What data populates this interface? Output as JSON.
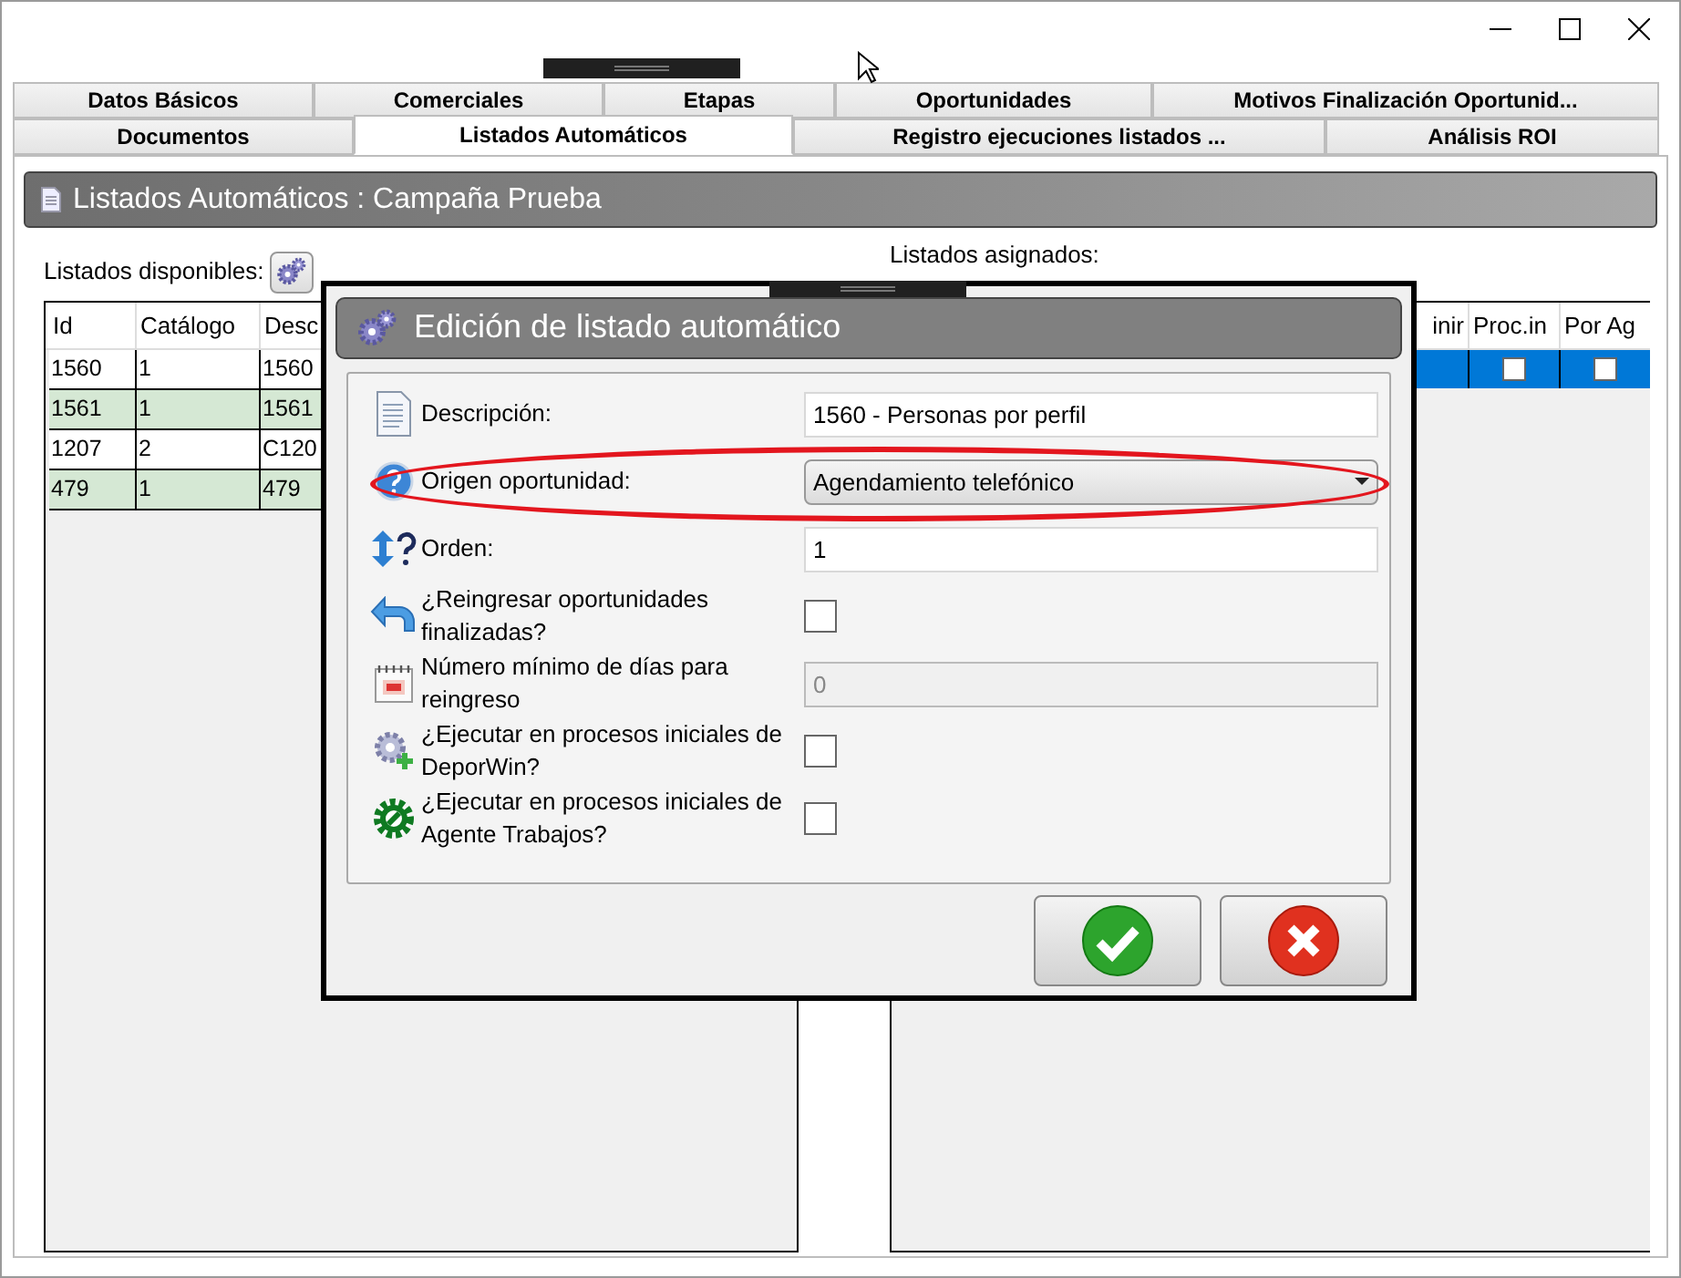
{
  "tabs": [
    [
      {
        "label": "Datos Básicos",
        "selected": false
      },
      {
        "label": "Comerciales",
        "selected": false
      },
      {
        "label": "Etapas",
        "selected": false
      },
      {
        "label": "Oportunidades",
        "selected": false
      },
      {
        "label": "Motivos Finalización Oportunid...",
        "selected": false
      }
    ],
    [
      {
        "label": "Documentos",
        "selected": false
      },
      {
        "label": "Listados Automáticos",
        "selected": true
      },
      {
        "label": "Registro ejecuciones listados ...",
        "selected": false
      },
      {
        "label": "Análisis ROI",
        "selected": false
      }
    ]
  ],
  "header": {
    "title": "Listados Automáticos : Campaña Prueba"
  },
  "available": {
    "label": "Listados disponibles:",
    "columns": [
      "Id",
      "Catálogo",
      "Desc"
    ],
    "rows": [
      {
        "cells": [
          "1560",
          "1",
          "1560"
        ]
      },
      {
        "cells": [
          "1561",
          "1",
          "1561"
        ]
      },
      {
        "cells": [
          "1207",
          "2",
          "C120"
        ]
      },
      {
        "cells": [
          "479",
          "1",
          "479"
        ]
      }
    ]
  },
  "assigned": {
    "label": "Listados asignados:",
    "columns": [
      "inir",
      "Proc.in",
      "Por Ag"
    ],
    "rows": [
      {
        "selected": true,
        "proc_in": false,
        "por_ag": false
      }
    ]
  },
  "dialog": {
    "title": "Edición de listado automático",
    "fields": [
      {
        "kind": "text",
        "label": "Descripción:",
        "value": "1560 - Personas por perfil",
        "disabled": false
      },
      {
        "kind": "select",
        "label": "Origen oportunidad:",
        "value": "Agendamiento telefónico",
        "highlighted": true
      },
      {
        "kind": "text",
        "label": "Orden:",
        "value": "1",
        "disabled": false
      },
      {
        "kind": "checkbox",
        "label": "¿Reingresar oportunidades finalizadas?",
        "checked": false
      },
      {
        "kind": "text",
        "label": "Número mínimo de días para reingreso",
        "value": "0",
        "disabled": true
      },
      {
        "kind": "checkbox",
        "label": "¿Ejecutar en procesos iniciales de DeporWin?",
        "checked": false
      },
      {
        "kind": "checkbox",
        "label": "¿Ejecutar en procesos iniciales de Agente Trabajos?",
        "checked": false
      }
    ],
    "buttons": [
      {
        "kind": "accept"
      },
      {
        "kind": "cancel"
      }
    ]
  }
}
